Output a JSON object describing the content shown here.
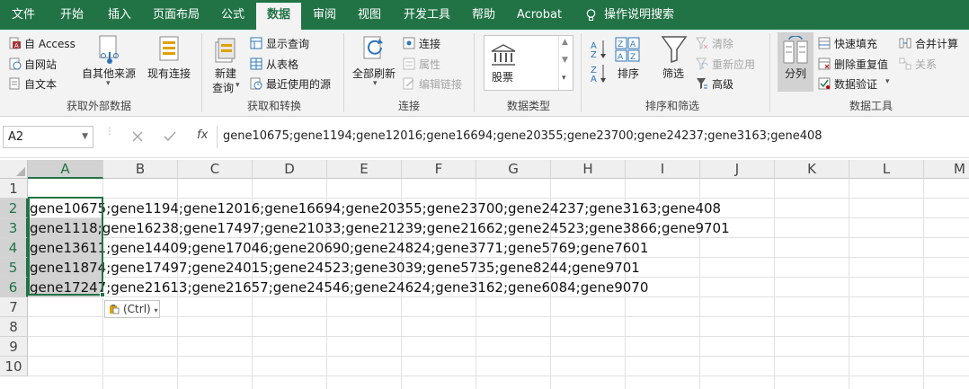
{
  "tabs": [
    {
      "label": "文件",
      "active": false
    },
    {
      "label": "开始",
      "active": false
    },
    {
      "label": "插入",
      "active": false
    },
    {
      "label": "页面布局",
      "active": false
    },
    {
      "label": "公式",
      "active": false
    },
    {
      "label": "数据",
      "active": true
    },
    {
      "label": "审阅",
      "active": false
    },
    {
      "label": "视图",
      "active": false
    },
    {
      "label": "开发工具",
      "active": false
    },
    {
      "label": "帮助",
      "active": false
    },
    {
      "label": "Acrobat",
      "active": false
    },
    {
      "label": "操作说明搜索",
      "active": false
    }
  ],
  "ribbon": {
    "get_external": {
      "label": "获取外部数据",
      "access": "自 Access",
      "web": "自网站",
      "text": "自文本",
      "other": "自其他来源",
      "existing": "现有连接"
    },
    "get_transform": {
      "label": "获取和转换",
      "new_query_1": "新建",
      "new_query_2": "查询",
      "show_queries": "显示查询",
      "from_table": "从表格",
      "recent_sources": "最近使用的源"
    },
    "connections": {
      "label": "连接",
      "refresh_all": "全部刷新",
      "connections": "连接",
      "properties": "属性",
      "edit_links": "编辑链接"
    },
    "data_types": {
      "label": "数据类型",
      "stocks": "股票"
    },
    "sort_filter": {
      "label": "排序和筛选",
      "sort": "排序",
      "filter": "筛选",
      "clear": "清除",
      "reapply": "重新应用",
      "advanced": "高级"
    },
    "data_tools": {
      "label": "数据工具",
      "text_to_columns": "分列",
      "flash_fill": "快速填充",
      "remove_duplicates": "删除重复值",
      "data_validation": "数据验证",
      "consolidate": "合并计算",
      "relationships": "关系"
    }
  },
  "formula_bar": {
    "name_box": "A2",
    "fx": "fx",
    "value": "gene10675;gene1194;gene12016;gene16694;gene20355;gene23700;gene24237;gene3163;gene408"
  },
  "grid": {
    "columns": [
      "A",
      "B",
      "C",
      "D",
      "E",
      "F",
      "G",
      "H",
      "I",
      "J",
      "K",
      "L",
      "M"
    ],
    "rows": [
      "1",
      "2",
      "3",
      "4",
      "5",
      "6",
      "7",
      "8",
      "9",
      "10"
    ],
    "cells": [
      "",
      "gene10675;gene1194;gene12016;gene16694;gene20355;gene23700;gene24237;gene3163;gene408",
      "gene1118;gene16238;gene17497;gene21033;gene21239;gene21662;gene24523;gene3866;gene9701",
      "gene13611;gene14409;gene17046;gene20690;gene24824;gene3771;gene5769;gene7601",
      "gene11874;gene17497;gene24015;gene24523;gene3039;gene5735;gene8244;gene9701",
      "gene17247;gene21613;gene21657;gene24546;gene24624;gene3162;gene6084;gene9070",
      "",
      "",
      "",
      ""
    ],
    "selected_cell": "A2",
    "selected_column": "A"
  },
  "paste_options": "(Ctrl)",
  "colors": {
    "accent": "#217346",
    "selection_fill": "#d2d2d2"
  }
}
